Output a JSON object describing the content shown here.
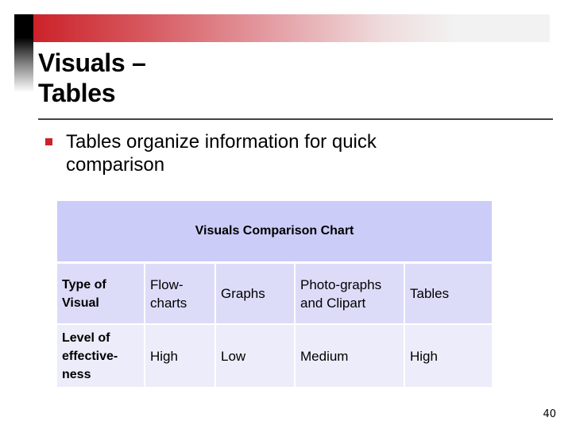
{
  "slide": {
    "title_line1": "Visuals –",
    "title_line2": "Tables",
    "bullets": [
      {
        "icon": "square-bullet-icon",
        "text": "Tables organize information for quick comparison"
      }
    ],
    "page_number": "40"
  },
  "colors": {
    "accent_red": "#cc2229",
    "table_header_bg": "#ccccf8",
    "row1_bg": "#dcdcf9",
    "row2_bg": "#ececfb"
  },
  "table": {
    "header": "Visuals Comparison Chart",
    "rows": [
      {
        "label": "Type of Visual",
        "cells": [
          "Flow-charts",
          "Graphs",
          "Photo-graphs and Clipart",
          "Tables"
        ]
      },
      {
        "label": "Level of effective-ness",
        "cells": [
          "High",
          "Low",
          "Medium",
          "High"
        ]
      }
    ]
  }
}
